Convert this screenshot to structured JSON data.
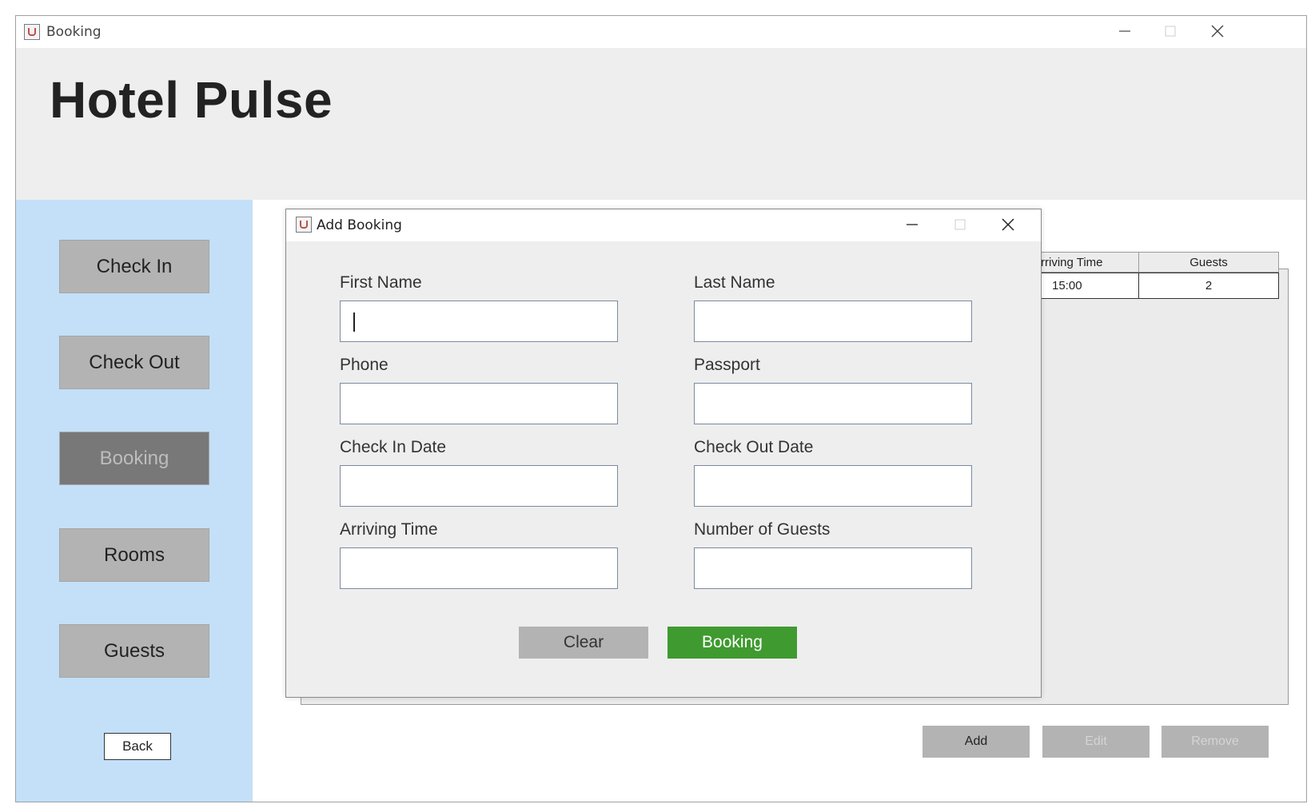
{
  "window": {
    "title": "Booking"
  },
  "header": {
    "app_title": "Hotel Pulse"
  },
  "sidebar": {
    "items": [
      {
        "label": "Check In"
      },
      {
        "label": "Check Out"
      },
      {
        "label": "Booking",
        "active": true
      },
      {
        "label": "Rooms"
      },
      {
        "label": "Guests"
      }
    ],
    "back_label": "Back"
  },
  "table": {
    "columns": [
      "Arriving Time",
      "Guests"
    ],
    "rows": [
      {
        "arriving_time": "15:00",
        "guests": "2"
      }
    ]
  },
  "actions": {
    "add": "Add",
    "edit": "Edit",
    "remove": "Remove"
  },
  "dialog": {
    "title": "Add Booking",
    "fields": {
      "first_name": {
        "label": "First Name",
        "value": ""
      },
      "last_name": {
        "label": "Last Name",
        "value": ""
      },
      "phone": {
        "label": "Phone",
        "value": ""
      },
      "passport": {
        "label": "Passport",
        "value": ""
      },
      "check_in_date": {
        "label": "Check In Date",
        "value": ""
      },
      "check_out_date": {
        "label": "Check Out Date",
        "value": ""
      },
      "arriving_time": {
        "label": "Arriving Time",
        "value": ""
      },
      "number_of_guests": {
        "label": "Number of Guests",
        "value": ""
      }
    },
    "clear_label": "Clear",
    "booking_label": "Booking"
  },
  "colors": {
    "sidebar_bg": "#c3e0f8",
    "header_bg": "#eeeeee",
    "button_gray": "#b3b3b3",
    "active_nav": "#787878",
    "booking_green": "#3f9a30"
  },
  "icons": [
    "java-app-icon",
    "minimize-icon",
    "maximize-icon",
    "close-icon"
  ]
}
